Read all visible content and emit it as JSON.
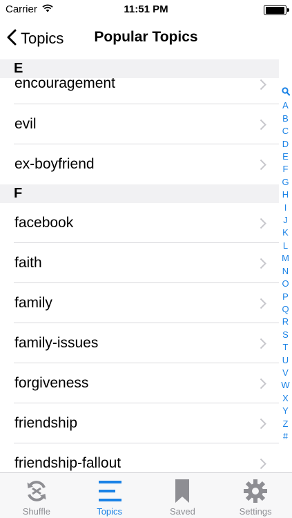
{
  "status_bar": {
    "carrier": "Carrier",
    "time": "11:51 PM",
    "battery_level": 0.95
  },
  "nav": {
    "back_label": "Topics",
    "title": "Popular Topics"
  },
  "list": {
    "sections": [
      {
        "header": "E",
        "items": [
          "encouragement",
          "evil",
          "ex-boyfriend"
        ]
      },
      {
        "header": "F",
        "items": [
          "facebook",
          "faith",
          "family",
          "family-issues",
          "forgiveness",
          "friendship",
          "friendship-fallout"
        ]
      }
    ]
  },
  "index": [
    "Q",
    "A",
    "B",
    "C",
    "D",
    "E",
    "F",
    "G",
    "H",
    "I",
    "J",
    "K",
    "L",
    "M",
    "N",
    "O",
    "P",
    "Q",
    "R",
    "S",
    "T",
    "U",
    "V",
    "W",
    "X",
    "Y",
    "Z",
    "#"
  ],
  "tabs": [
    {
      "label": "Shuffle",
      "icon": "shuffle-icon",
      "active": false
    },
    {
      "label": "Topics",
      "icon": "topics-list-icon",
      "active": true
    },
    {
      "label": "Saved",
      "icon": "bookmark-icon",
      "active": false
    },
    {
      "label": "Settings",
      "icon": "gear-icon",
      "active": false
    }
  ],
  "colors": {
    "accent": "#1a82e6",
    "inactive": "#8e8e93",
    "section_bg": "#f1f1f3",
    "chevron": "#c7c7cc"
  }
}
